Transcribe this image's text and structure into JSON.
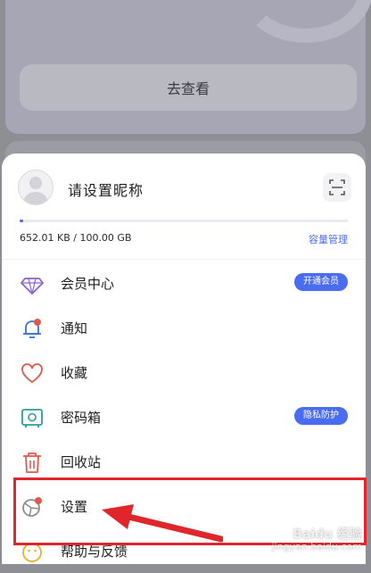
{
  "background": {
    "view_button_label": "去查看"
  },
  "profile": {
    "nickname": "请设置昵称"
  },
  "storage": {
    "usage_text": "652.01 KB / 100.00 GB",
    "manage_link": "容量管理",
    "used_fraction": 6.4e-06
  },
  "menu": {
    "items": [
      {
        "label": "会员中心",
        "icon": "diamond-icon",
        "badge": "开通会员"
      },
      {
        "label": "通知",
        "icon": "bell-icon"
      },
      {
        "label": "收藏",
        "icon": "heart-icon"
      },
      {
        "label": "密码箱",
        "icon": "safe-icon",
        "badge": "隐私防护"
      },
      {
        "label": "回收站",
        "icon": "trash-icon"
      },
      {
        "label": "设置",
        "icon": "settings-icon"
      },
      {
        "label": "帮助与反馈",
        "icon": "help-icon"
      }
    ]
  },
  "watermark": {
    "title": "Baidu 经验",
    "url": "jingyan.baidu.com"
  },
  "colors": {
    "accent": "#4a6cf0",
    "annotation": "#e0262a",
    "icon_red": "#e2574c"
  }
}
